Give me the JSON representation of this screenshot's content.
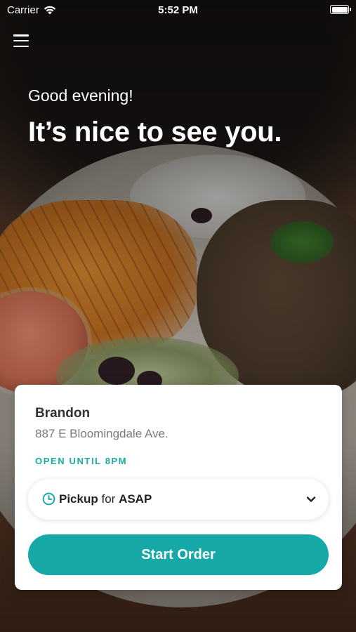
{
  "status_bar": {
    "carrier": "Carrier",
    "time": "5:52 PM",
    "icons": [
      "wifi-icon",
      "battery-icon"
    ]
  },
  "header": {
    "menu_icon": "hamburger-menu-icon",
    "greeting": "Good evening!",
    "headline": "It’s nice to see you."
  },
  "location": {
    "name": "Brandon",
    "address": "887 E Bloomingdale Ave.",
    "hours": "OPEN UNTIL 8PM"
  },
  "order_mode": {
    "icon": "clock-icon",
    "mode": "Pickup",
    "connector": "for",
    "time": "ASAP",
    "dropdown_icon": "chevron-down-icon"
  },
  "actions": {
    "start_order": "Start Order"
  },
  "colors": {
    "accent": "#17a9a8",
    "hours_text": "#1aa9a7",
    "card_bg": "#ffffff",
    "title_text": "#ffffff"
  }
}
